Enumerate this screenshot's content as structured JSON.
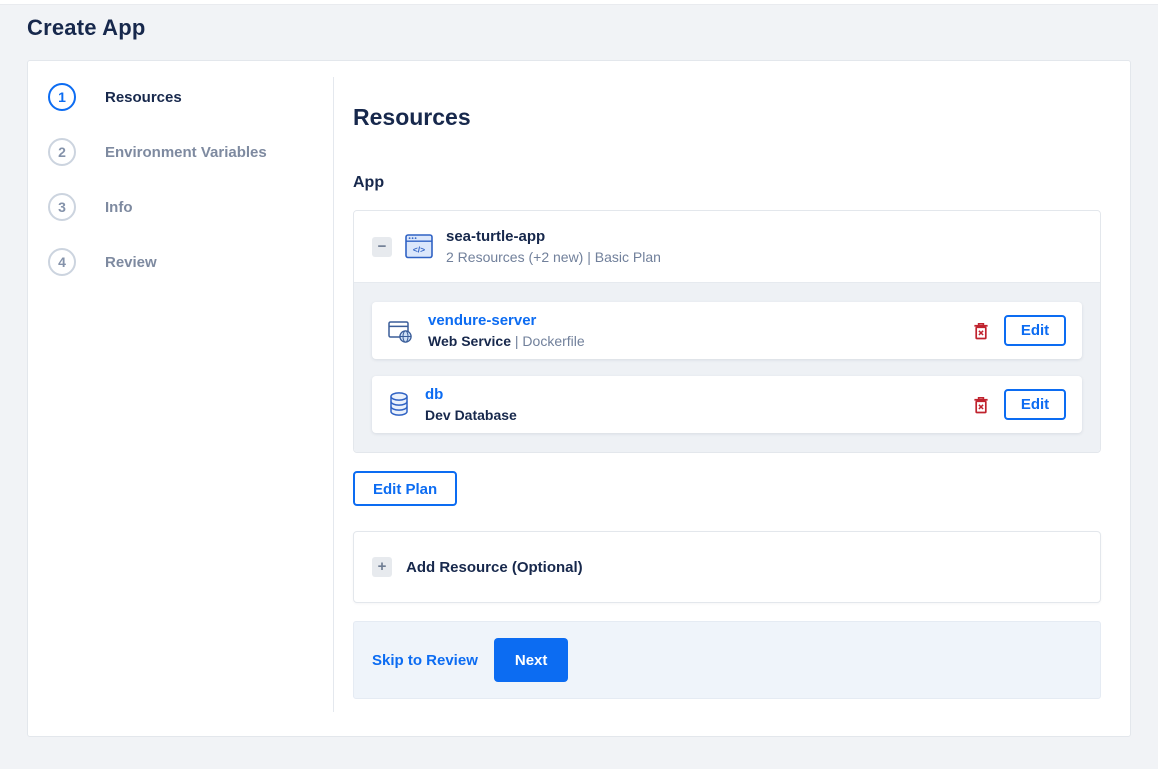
{
  "page": {
    "title": "Create App"
  },
  "colors": {
    "accent": "#0c6cf2",
    "navy": "#17284c",
    "muted_text": "#71809b",
    "danger": "#c0232e",
    "page_bg": "#f1f3f6",
    "panel_gray": "#eef1f5",
    "footer_bg": "#eff4fa"
  },
  "stepper": [
    {
      "number": "1",
      "label": "Resources",
      "active": true
    },
    {
      "number": "2",
      "label": "Environment Variables",
      "active": false
    },
    {
      "number": "3",
      "label": "Info",
      "active": false
    },
    {
      "number": "4",
      "label": "Review",
      "active": false
    }
  ],
  "main": {
    "heading": "Resources",
    "section_label": "App",
    "app": {
      "name": "sea-turtle-app",
      "icon": "app-window-code-icon",
      "summary": "2 Resources (+2 new) | Basic Plan",
      "separator": "|",
      "resources": [
        {
          "name": "vendure-server",
          "icon": "web-service-icon",
          "type": "Web Service",
          "source": "Dockerfile",
          "edit_label": "Edit"
        },
        {
          "name": "db",
          "icon": "database-icon",
          "type": "Dev Database",
          "source": "",
          "edit_label": "Edit"
        }
      ]
    },
    "edit_plan_label": "Edit Plan",
    "add_resource_label": "Add Resource (Optional)",
    "footer": {
      "skip_label": "Skip to Review",
      "next_label": "Next"
    }
  }
}
